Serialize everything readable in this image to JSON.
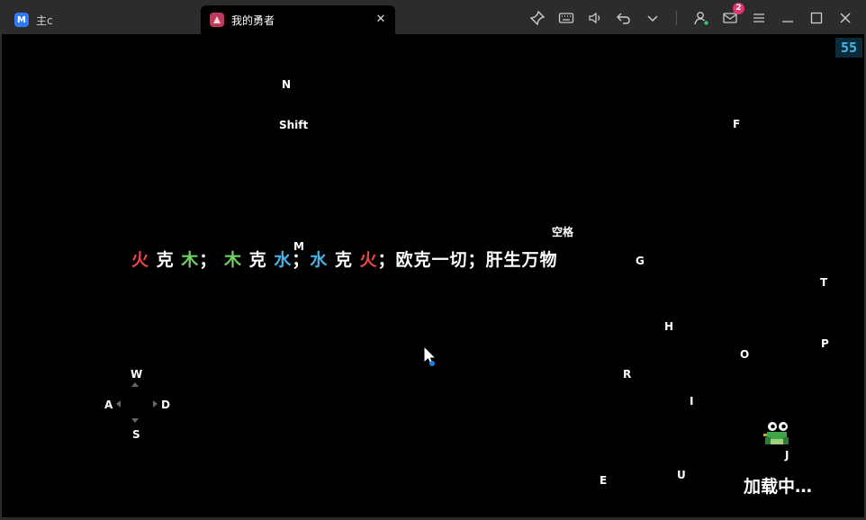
{
  "tabs": [
    {
      "label": "主c",
      "favicon_icon": "app-logo-icon",
      "active": false
    },
    {
      "label": "我的勇者",
      "favicon_icon": "game-icon",
      "active": true
    }
  ],
  "toolbar": {
    "icons": [
      "pin-icon",
      "keyboard-icon",
      "volume-icon",
      "undo-icon",
      "chevron-down-icon",
      "user-icon",
      "mail-icon",
      "menu-icon",
      "minimize-icon",
      "maximize-icon",
      "close-icon"
    ],
    "mail_badge": "2"
  },
  "game": {
    "fps": "55",
    "keys": {
      "n": "N",
      "shift": "Shift",
      "f": "F",
      "space": "空格",
      "m": "M",
      "g": "G",
      "t": "T",
      "h": "H",
      "p": "P",
      "o": "O",
      "r": "R",
      "w": "W",
      "a": "A",
      "d": "D",
      "s": "S",
      "i": "I",
      "j": "J",
      "e": "E",
      "u": "U"
    },
    "slogan": {
      "s1": "火",
      "s2": "克",
      "s3": "木",
      "s4": "；",
      "s5": "木",
      "s6": "克",
      "s7": "水",
      "s8": "；",
      "s9": "水",
      "s10": "克",
      "s11": "火",
      "s12": "；欧克一切；肝生万物"
    },
    "loading": "加载中…"
  },
  "colors": {
    "fire": "#e84545",
    "wood": "#6fcf63",
    "water": "#46b3e6",
    "fps_text": "#3fb9e8",
    "badge": "#e0366c"
  }
}
